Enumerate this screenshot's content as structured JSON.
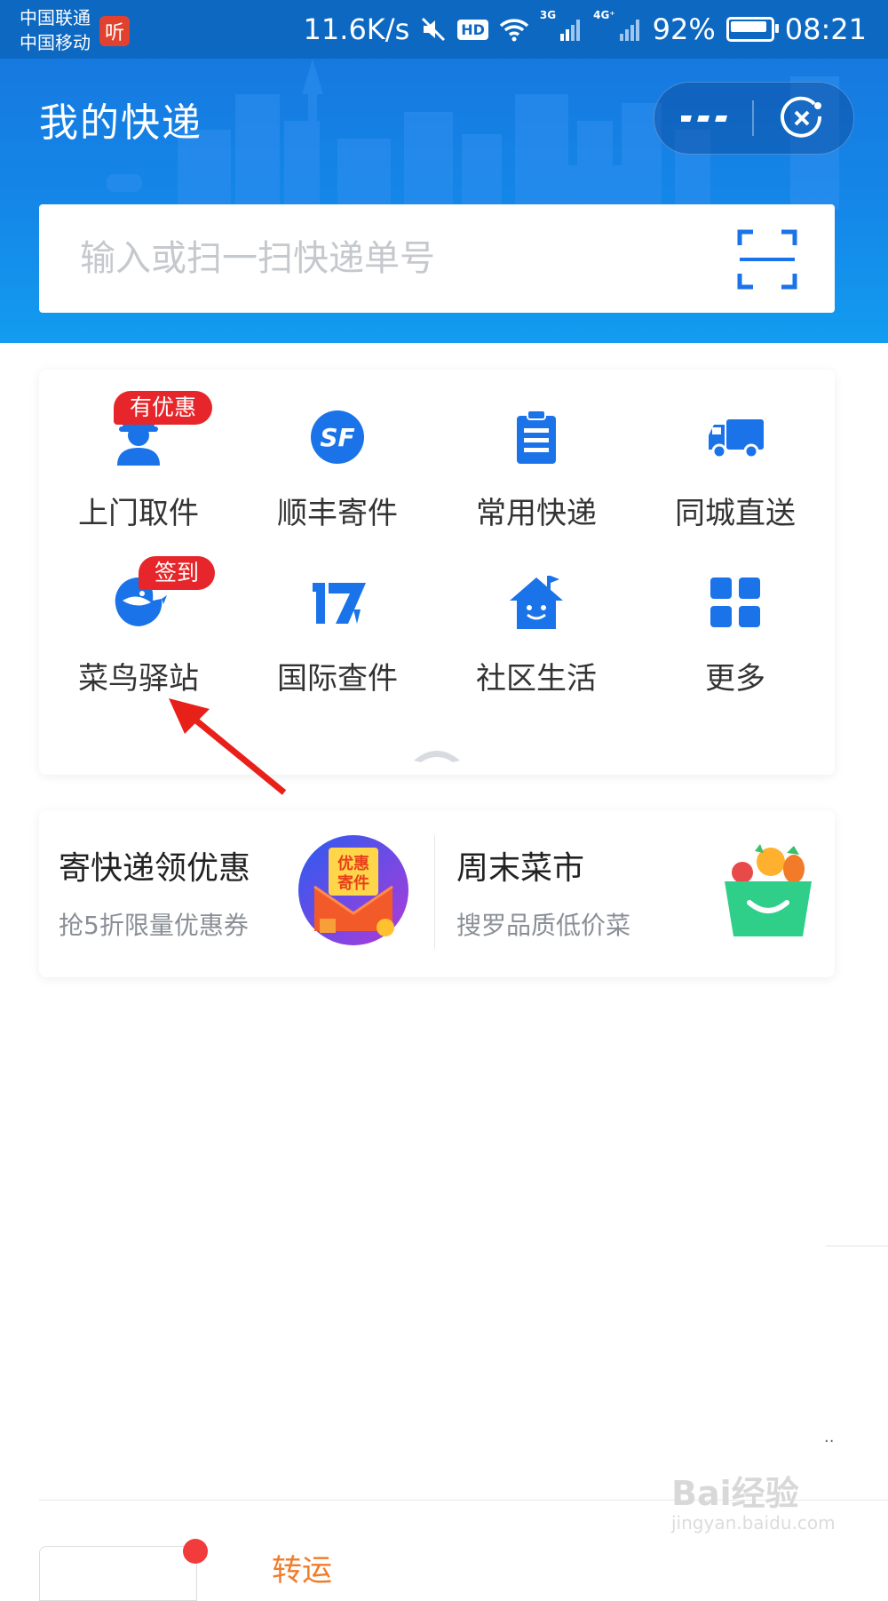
{
  "status_bar": {
    "carrier1": "中国联通",
    "carrier2": "中国移动",
    "listen_app": "听",
    "speed": "11.6K/s",
    "hd": "HD",
    "net3g": "3G",
    "net4g": "4G⁺",
    "battery": "92%",
    "time": "08:21"
  },
  "header": {
    "title": "我的快递",
    "search_placeholder": "输入或扫一扫快递单号"
  },
  "services": [
    {
      "label": "上门取件",
      "badge": "有优惠",
      "icon": "courier-person-icon"
    },
    {
      "label": "顺丰寄件",
      "badge": "",
      "icon": "sf-logo-icon"
    },
    {
      "label": "常用快递",
      "badge": "",
      "icon": "clipboard-icon"
    },
    {
      "label": "同城直送",
      "badge": "",
      "icon": "truck-icon"
    },
    {
      "label": "菜鸟驿站",
      "badge": "签到",
      "icon": "cainiao-bird-icon"
    },
    {
      "label": "国际查件",
      "badge": "",
      "icon": "17track-icon"
    },
    {
      "label": "社区生活",
      "badge": "",
      "icon": "community-house-icon"
    },
    {
      "label": "更多",
      "badge": "",
      "icon": "grid-more-icon"
    }
  ],
  "promos": [
    {
      "title": "寄快递领优惠",
      "subtitle": "抢5折限量优惠券",
      "art_text": [
        "优惠",
        "寄件"
      ]
    },
    {
      "title": "周末菜市",
      "subtitle": "搜罗品质低价菜"
    }
  ],
  "bottom": {
    "orange_text": "转运",
    "dots": "··"
  },
  "watermark": {
    "brand": "Bai经验",
    "url": "jingyan.baidu.com"
  },
  "colors": {
    "brand_blue": "#1a73e8",
    "header_blue": "#1488e8",
    "badge_red": "#e6262a",
    "status_bar": "#0d68c2"
  }
}
